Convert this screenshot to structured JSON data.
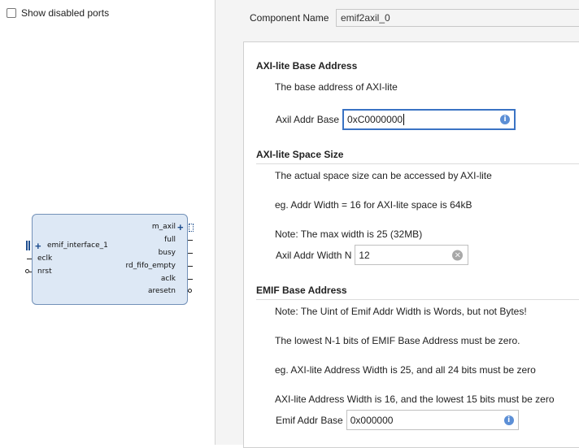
{
  "left_panel": {
    "show_disabled_ports_label": "Show disabled ports",
    "show_disabled_ports_checked": false,
    "block": {
      "right_pins": [
        "m_axil",
        "full",
        "busy",
        "rd_fifo_empty",
        "aclk",
        "aresetn"
      ],
      "left_pins": [
        "emif_interface_1",
        "eclk",
        "nrst"
      ]
    }
  },
  "right_panel": {
    "component_name_label": "Component Name",
    "component_name_value": "emif2axil_0",
    "sections": {
      "axi_base": {
        "title": "AXI-lite Base Address",
        "description": "The base address of AXI-lite",
        "field_label": "Axil Addr Base",
        "field_value": "0xC0000000"
      },
      "axi_space": {
        "title": "AXI-lite Space Size",
        "line1": "The actual space size can be accessed by AXI-lite",
        "line2": "eg. Addr Width = 16 for AXI-lite space is 64kB",
        "line3": "Note: The max width is 25 (32MB)",
        "field_label": "Axil Addr Width N",
        "field_value": "12"
      },
      "emif_base": {
        "title": "EMIF Base Address",
        "line1": "Note: The Uint of Emif Addr Width is Words, but not Bytes!",
        "line2": "The lowest N-1 bits of EMIF Base Address must be zero.",
        "line3": "eg. AXI-lite Address Width is 25, and all 24 bits must be zero",
        "line4": "AXI-lite Address Width is 16, and the lowest 15 bits must be zero",
        "field_label": "Emif Addr Base",
        "field_value": "0x000000"
      }
    }
  },
  "colors": {
    "accent": "#3a73c4",
    "block_fill": "#dde8f5",
    "block_border": "#7391b8"
  }
}
